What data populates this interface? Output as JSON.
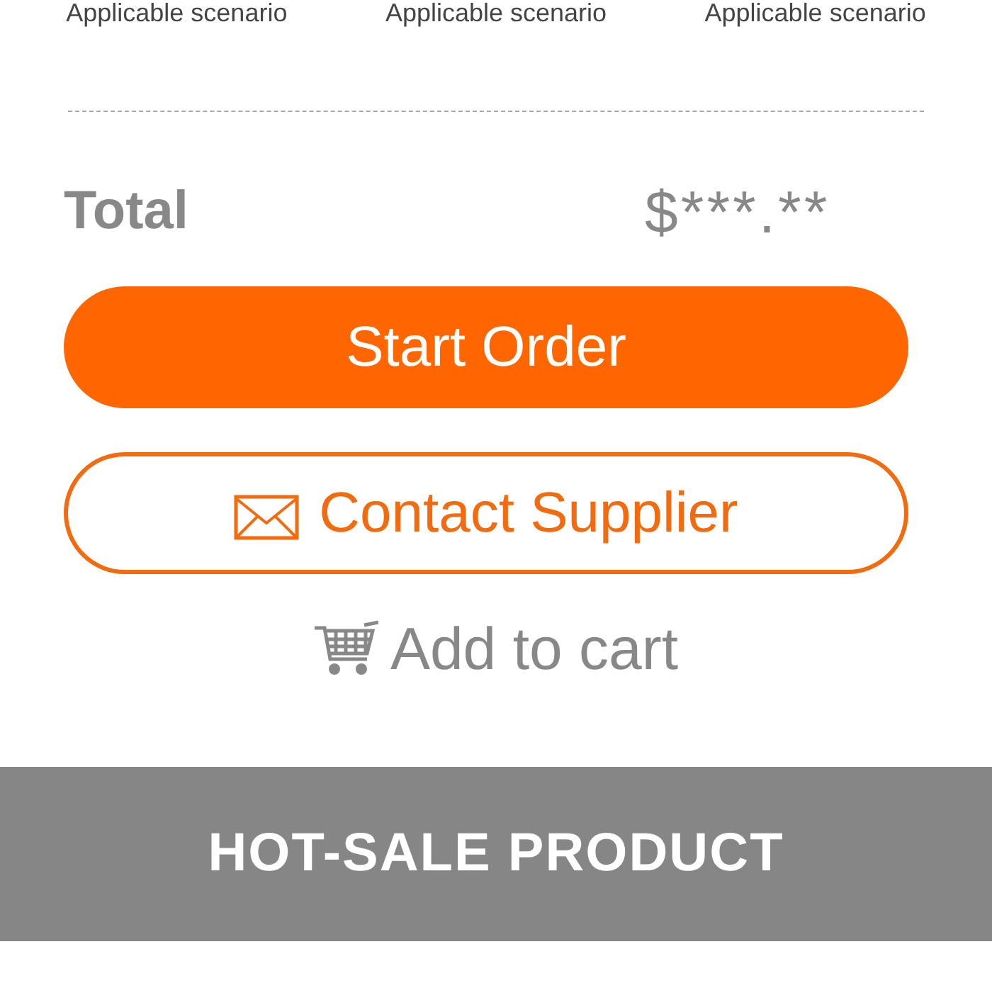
{
  "scenarios": [
    "Applicable scenario",
    "Applicable scenario",
    "Applicable scenario"
  ],
  "total": {
    "label": "Total",
    "price": "$***.**"
  },
  "actions": {
    "start_order": "Start Order",
    "contact_supplier": "Contact Supplier",
    "add_to_cart": "Add to cart"
  },
  "banner": {
    "title": "HOT-SALE PRODUCT"
  }
}
